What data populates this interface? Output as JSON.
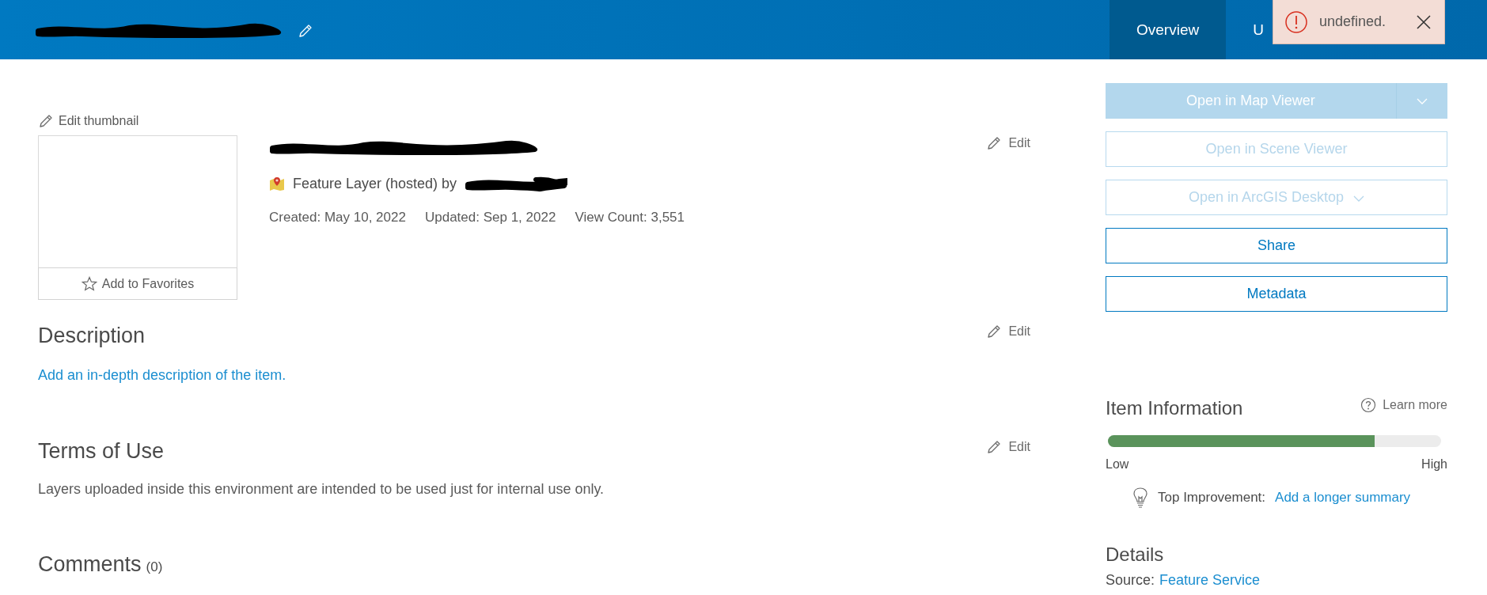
{
  "header": {
    "tabs": [
      {
        "label": "Overview",
        "selected": true
      },
      {
        "label": "U",
        "selected": false
      }
    ]
  },
  "toast": {
    "message": "undefined."
  },
  "item": {
    "edit_thumbnail": "Edit thumbnail",
    "favorites": "Add to Favorites",
    "edit": "Edit",
    "type_text": "Feature Layer (hosted) by",
    "meta": [
      "Created: May 10, 2022",
      "Updated: Sep 1, 2022",
      "View Count: 3,551"
    ]
  },
  "sections": [
    {
      "kind": "link",
      "title": "Description",
      "edit": "Edit",
      "body": "Add an in-depth description of the item."
    },
    {
      "kind": "text",
      "title": "Terms of Use",
      "edit": "Edit",
      "body": "Layers uploaded inside this environment are intended to be used just for internal use only."
    },
    {
      "kind": "count",
      "title": "Comments",
      "count": "(0)"
    }
  ],
  "actions": [
    {
      "kind": "split",
      "label": "Open in Map Viewer",
      "disabled": true
    },
    {
      "kind": "plain",
      "label": "Open in Scene Viewer",
      "disabled": true
    },
    {
      "kind": "menu",
      "label": "Open in ArcGIS Desktop",
      "disabled": true
    },
    {
      "kind": "plain",
      "label": "Share",
      "disabled": false
    },
    {
      "kind": "plain",
      "label": "Metadata",
      "disabled": false
    }
  ],
  "item_information": {
    "title": "Item Information",
    "learn_more": "Learn more",
    "level": 0.8,
    "low": "Low",
    "high": "High",
    "improvement_label": "Top Improvement:",
    "improvement_link": "Add a longer summary"
  },
  "details": {
    "title": "Details",
    "source_label": "Source:",
    "source_link": "Feature Service"
  }
}
